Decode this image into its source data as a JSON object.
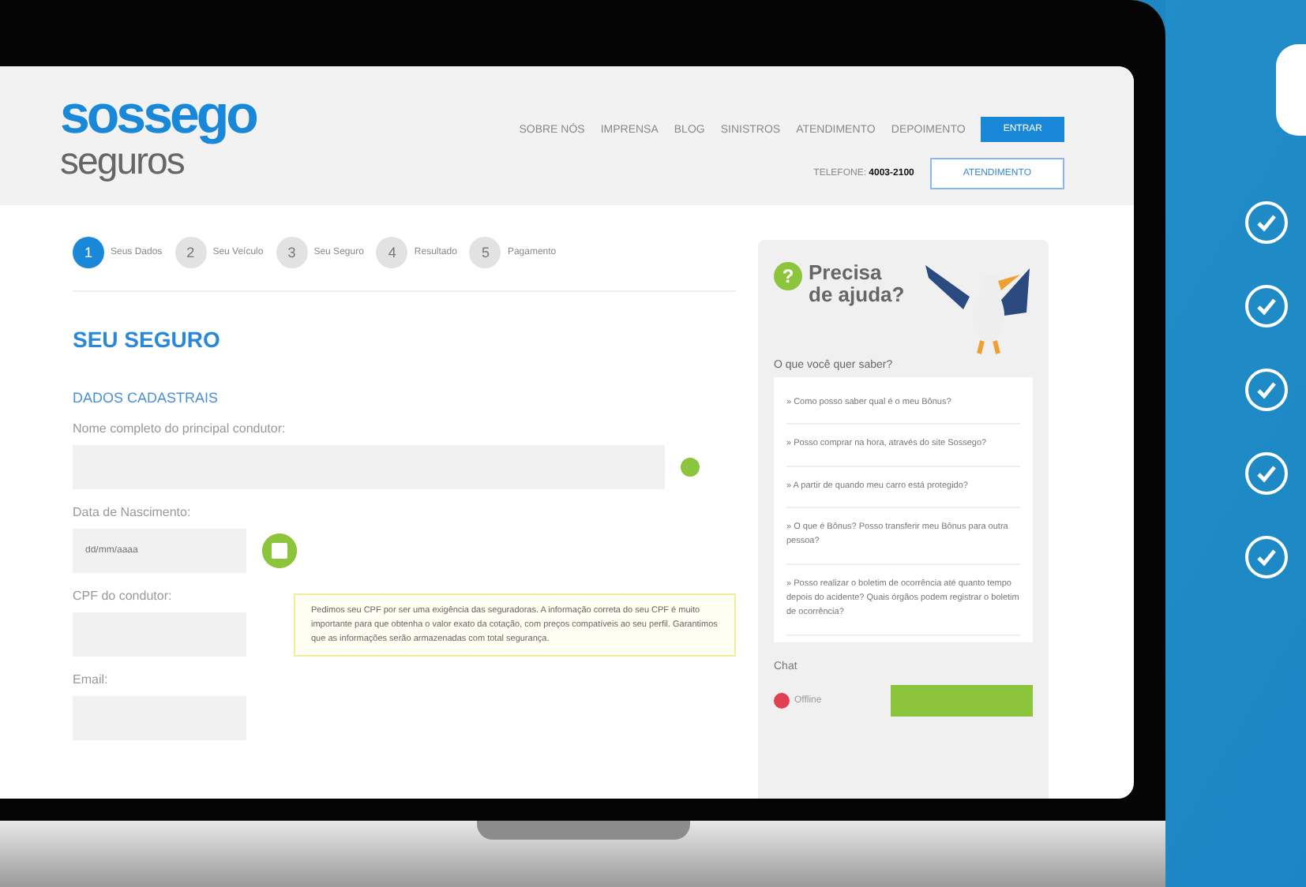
{
  "header": {
    "logo_top": "sossego",
    "logo_bottom": "seguros",
    "nav": [
      "SOBRE NÓS",
      "IMPRENSA",
      "BLOG",
      "SINISTROS",
      "ATENDIMENTO",
      "DEPOIMENTO"
    ],
    "login_button": "ENTRAR",
    "phone_label": "TELEFONE:",
    "phone": "4003-2100",
    "support_button": "ATENDIMENTO"
  },
  "steps": [
    {
      "number": "1",
      "label": "Seus Dados",
      "selected": true
    },
    {
      "number": "2",
      "label": "Seu Veículo",
      "selected": false
    },
    {
      "number": "3",
      "label": "Seu Seguro",
      "selected": false
    },
    {
      "number": "4",
      "label": "Resultado",
      "selected": false
    },
    {
      "number": "5",
      "label": "Pagamento",
      "selected": false
    }
  ],
  "form": {
    "title": "SEU SEGURO",
    "section": "DADOS CADASTRAIS",
    "fields": [
      {
        "label": "Nome completo do principal condutor:",
        "kind": "wide",
        "help": true
      },
      {
        "label": "Data de Nascimento:",
        "kind": "date",
        "placeholder": "dd/mm/aaaa"
      },
      {
        "label": "CPF do condutor:",
        "kind": "short",
        "tooltip": "Pedimos seu CPF por ser uma exigência das seguradoras. A informação correta do seu CPF é muito importante para que obtenha o valor exato da cotação, com preços compatíveis ao seu perfil. Garantimos que as informações serão armazenadas com total segurança."
      },
      {
        "label": "Email:",
        "kind": "short"
      }
    ]
  },
  "help": {
    "icon": "?",
    "title_1": "Precisa",
    "title_2": "de ajuda?",
    "question": "O que você quer saber?",
    "faq": [
      "» Como posso saber qual é o meu Bônus?",
      "» Posso comprar na hora, através do site Sossego?",
      "» A partir de quando meu carro está protegido?",
      "» O que é Bônus? Posso transferir meu Bônus para outra pessoa?",
      "» Posso realizar o boletim de ocorrência até quanto tempo depois do acidente? Quais órgãos podem registrar o boletim de ocorrência?"
    ],
    "chat": "Chat",
    "chat_status": "Offline"
  },
  "features": [
    {
      "checked": true
    },
    {
      "checked": true
    },
    {
      "checked": true
    },
    {
      "checked": true
    },
    {
      "checked": true
    }
  ]
}
